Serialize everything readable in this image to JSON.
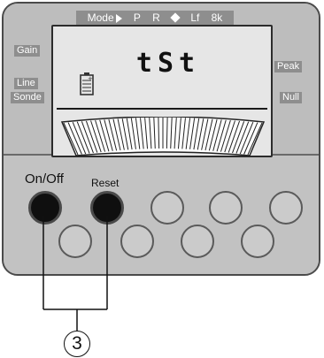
{
  "mode_bar": {
    "mode": "Mode",
    "items": [
      "P",
      "R",
      "Lf",
      "8k"
    ]
  },
  "lcd": {
    "text": "tSt"
  },
  "side_labels": {
    "gain": "Gain",
    "line": "Line",
    "sonde": "Sonde",
    "peak": "Peak",
    "null": "Null"
  },
  "buttons": {
    "on_off": "On/Off",
    "reset": "Reset"
  },
  "callout": {
    "number": "3"
  },
  "colors": {
    "panel": "#bdbdbd",
    "lcd": "#e6e6e6",
    "label_bg": "#8e8e8e",
    "dark_button": "#0f0f0f"
  }
}
